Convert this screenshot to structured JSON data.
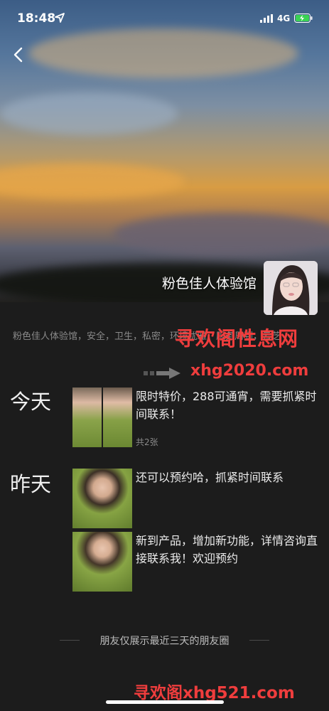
{
  "status_bar": {
    "time": "18:48",
    "network": "4G"
  },
  "profile": {
    "name": "粉色佳人体验馆",
    "signature": "粉色佳人体验馆，安全，卫生，私密，环境优雅，服务周到，云芝"
  },
  "posts": [
    {
      "day": "今天",
      "text": "限时特价，288可通宵，需要抓紧时间联系！",
      "count": "共2张"
    },
    {
      "day": "昨天",
      "text": "还可以预约哈，抓紧时间联系"
    },
    {
      "day": "",
      "text": "新到产品，增加新功能，详情咨询直接联系我！欢迎预约"
    }
  ],
  "footer": {
    "note": "朋友仅展示最近三天的朋友圈"
  },
  "watermarks": {
    "top": "寻欢阁性息网",
    "url1": "xhg2020.com",
    "bottom": "寻欢阁xhg521.com"
  },
  "colors": {
    "watermark": "#ef3d3d",
    "background": "#1c1c1c",
    "dress": "#7e9a3a"
  }
}
